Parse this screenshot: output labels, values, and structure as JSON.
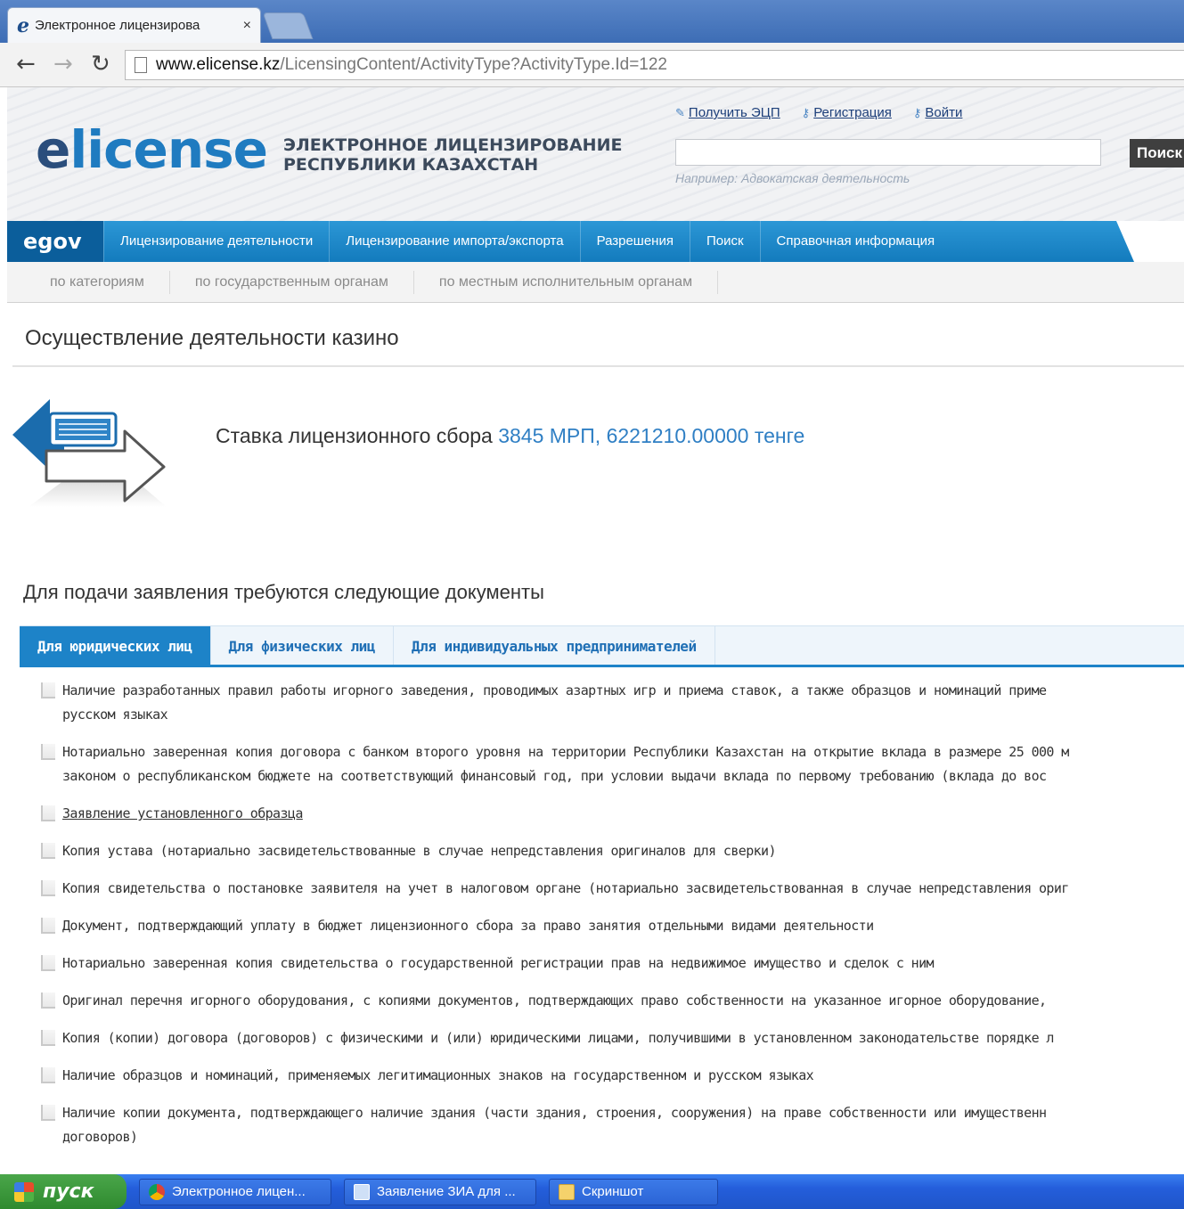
{
  "browser": {
    "tab_title": "Электронное лицензирова",
    "tab_favicon": "e",
    "url_host": "www.elicense.kz",
    "url_path": "/LicensingContent/ActivityType?ActivityType.Id=122"
  },
  "header": {
    "logo_e": "e",
    "logo_rest": "license",
    "tagline_line1": "ЭЛЕКТРОННОЕ ЛИЦЕНЗИРОВАНИЕ",
    "tagline_line2": "РЕСПУБЛИКИ КАЗАХСТАН",
    "links": [
      "Получить ЭЦП",
      "Регистрация",
      "Войти"
    ],
    "search_hint": "Например: Адвокатская деятельность",
    "search_button": "Поиск"
  },
  "mainnav": {
    "egov": "egov",
    "items": [
      "Лицензирование деятельности",
      "Лицензирование импорта/экспорта",
      "Разрешения",
      "Поиск",
      "Справочная информация"
    ]
  },
  "subnav": {
    "items": [
      "по категориям",
      "по государственным органам",
      "по местным исполнительным органам"
    ]
  },
  "page": {
    "title": "Осуществление деятельности казино",
    "fee_label": "Ставка лицензионного сбора",
    "fee_value": "3845 МРП, 6221210.00000 тенге",
    "docs_heading": "Для подачи заявления требуются следующие документы",
    "tabs": [
      "Для юридических лиц",
      "Для физических лиц",
      "Для индивидуальных предпринимателей"
    ],
    "docs": [
      {
        "line1": "Наличие разработанных правил работы игорного заведения, проводимых азартных игр и приема ставок, а также образцов и номинаций приме",
        "line2": "русском языках"
      },
      {
        "line1": "Нотариально заверенная копия договора с банком второго уровня на территории Республики Казахстан на открытие вклада в размере 25 000 м",
        "line2": "законом о республиканском бюджете на соответствующий финансовый год, при условии выдачи вклада по первому требованию (вклада до вос"
      },
      {
        "line1": "Заявление установленного образца"
      },
      {
        "line1": "Копия устава (нотариально засвидетельствованные в случае непредставления оригиналов для сверки)"
      },
      {
        "line1": "Копия свидетельства о постановке заявителя на учет в налоговом органе (нотариально засвидетельствованная в случае непредставления ориг"
      },
      {
        "line1": "Документ, подтверждающий уплату в бюджет лицензионного сбора за право занятия отдельными видами деятельности"
      },
      {
        "line1": "Нотариально заверенная копия свидетельства о государственной регистрации прав на недвижимое имущество и сделок с ним"
      },
      {
        "line1": "Оригинал перечня игорного оборудования, с копиями документов, подтверждающих право собственности на указанное игорное оборудование,"
      },
      {
        "line1": "Копия (копии) договора (договоров) с физическими и (или) юридическими лицами, получившими в установленном законодательстве порядке л"
      },
      {
        "line1": "Наличие образцов и номинаций, применяемых легитимационных знаков на государственном и русском языках"
      },
      {
        "line1": "Наличие копии документа, подтверждающего наличие здания (части здания, строения, сооружения) на праве собственности или имущественн",
        "line2": "договоров)"
      }
    ]
  },
  "taskbar": {
    "start": "пуск",
    "tasks": [
      "Электронное лицен...",
      "Заявление ЗИА для ...",
      "Скриншот"
    ]
  }
}
